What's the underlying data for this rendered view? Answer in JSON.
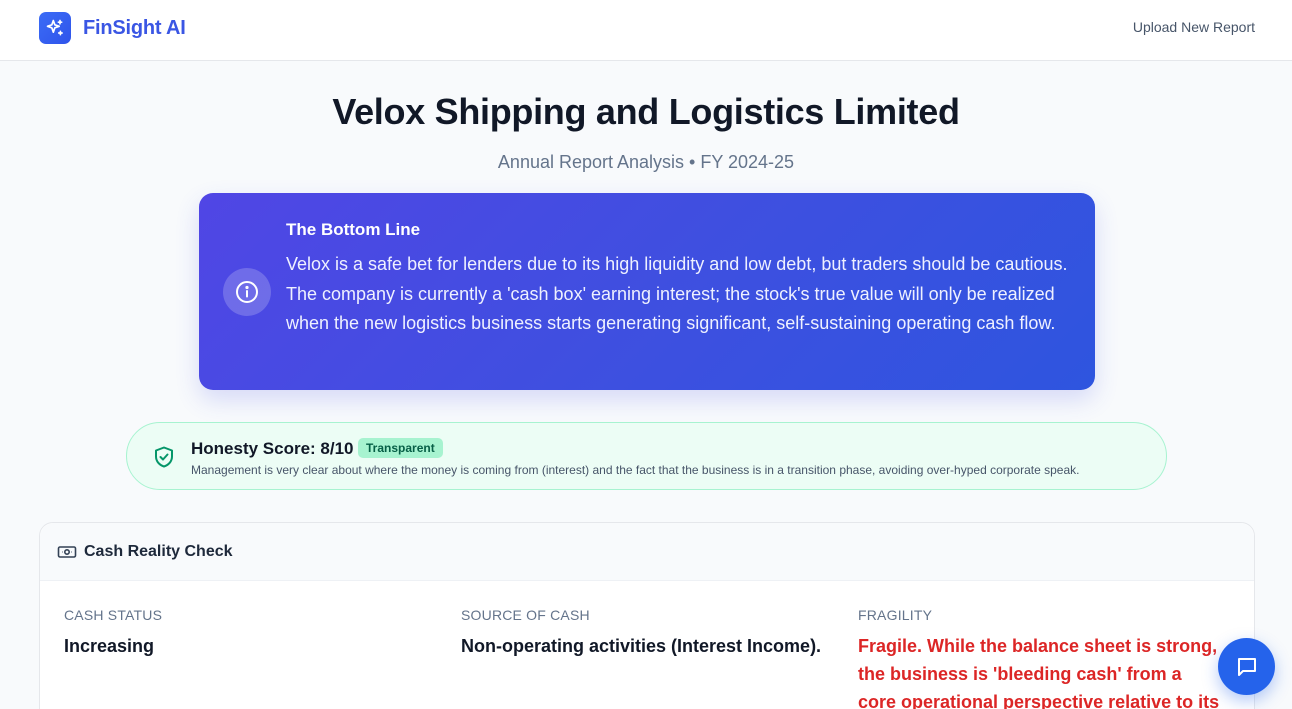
{
  "header": {
    "brand_name": "FinSight AI",
    "logo_icon": "sparkles-icon",
    "upload_label": "Upload New Report"
  },
  "report": {
    "title": "Velox Shipping and Logistics Limited",
    "subtitle": "Annual Report Analysis • FY 2024-25"
  },
  "bottom_line": {
    "icon": "info-icon",
    "heading": "The Bottom Line",
    "text": "Velox is a safe bet for lenders due to its high liquidity and low debt, but traders should be cautious. The company is currently a 'cash box' earning interest; the stock's true value will only be realized when the new logistics business starts generating significant, self-sustaining operating cash flow."
  },
  "honesty": {
    "icon": "shield-check-icon",
    "title": "Honesty Score: 8/10",
    "score": 8,
    "max_score": 10,
    "badge": "Transparent",
    "description": "Management is very clear about where the money is coming from (interest) and the fact that the business is in a transition phase, avoiding over-hyped corporate speak."
  },
  "cash_reality": {
    "icon": "banknote-icon",
    "title": "Cash Reality Check",
    "columns": [
      {
        "label": "CASH STATUS",
        "value": "Increasing"
      },
      {
        "label": "SOURCE OF CASH",
        "value": "Non-operating activities (Interest Income)."
      },
      {
        "label": "FRAGILITY",
        "value": "Fragile. While the balance sheet is strong, the business is 'bleeding cash' from a core operational perspective relative to its"
      }
    ]
  },
  "chat": {
    "icon": "chat-bubble-icon"
  },
  "colors": {
    "brand": "#3a56e4",
    "card_gradient_start": "#5046e5",
    "card_gradient_end": "#2e55df",
    "honesty_bg": "#ecfdf5",
    "honesty_border": "#a7f3d0",
    "danger": "#dc2626",
    "fab": "#2563eb"
  }
}
